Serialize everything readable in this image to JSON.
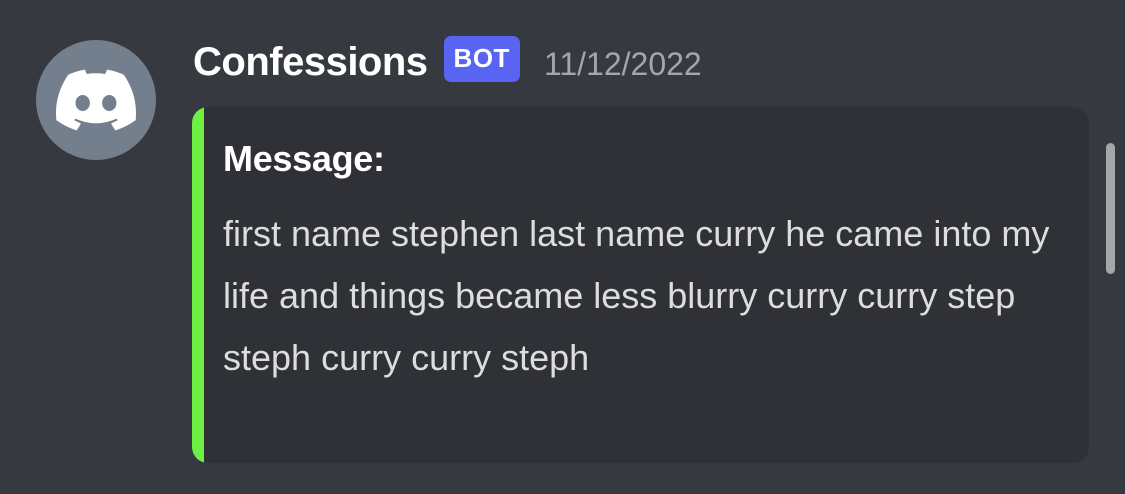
{
  "message": {
    "author": "Confessions",
    "bot_tag": "BOT",
    "timestamp": "11/12/2022",
    "avatar_icon": "discord-logo-icon",
    "embed": {
      "accent_color": "#6df043",
      "field_name": "Message:",
      "field_value": "first name stephen last name curry he came into my life and things became less blurry curry curry step steph curry curry steph"
    }
  },
  "colors": {
    "background": "#36393f",
    "embed_background": "#2f3136",
    "bot_tag": "#5865f2",
    "avatar": "#747f8d"
  }
}
